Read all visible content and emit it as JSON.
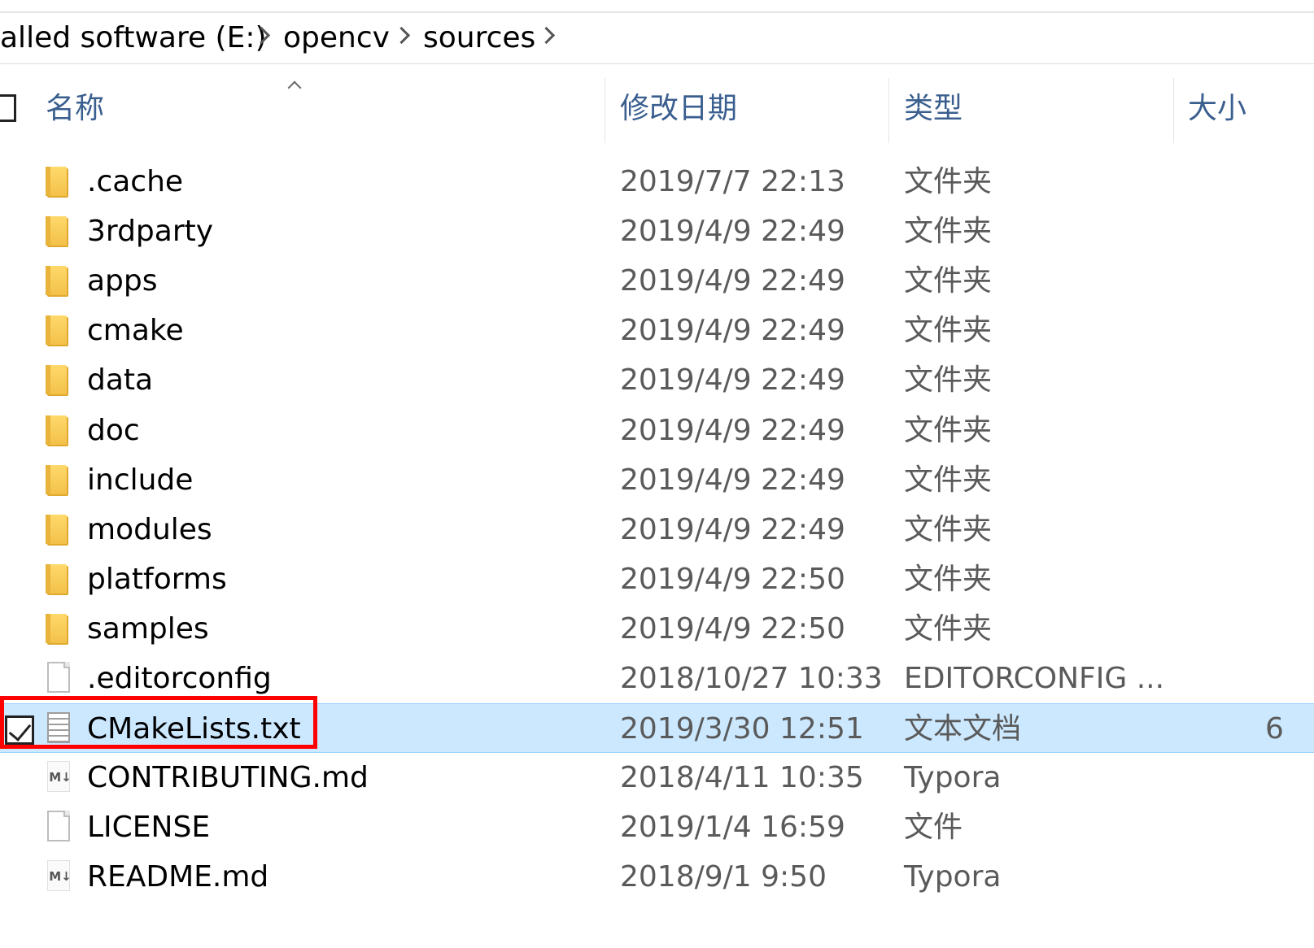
{
  "breadcrumb": {
    "items": [
      "alled software (E:)",
      "opencv",
      "sources"
    ]
  },
  "columns": {
    "name": "名称",
    "modified": "修改日期",
    "type": "类型",
    "size": "大小"
  },
  "files": [
    {
      "name": ".cache",
      "modified": "2019/7/7 22:13",
      "type": "文件夹",
      "size": "",
      "icon": "folder-icon"
    },
    {
      "name": "3rdparty",
      "modified": "2019/4/9 22:49",
      "type": "文件夹",
      "size": "",
      "icon": "folder-icon"
    },
    {
      "name": "apps",
      "modified": "2019/4/9 22:49",
      "type": "文件夹",
      "size": "",
      "icon": "folder-icon"
    },
    {
      "name": "cmake",
      "modified": "2019/4/9 22:49",
      "type": "文件夹",
      "size": "",
      "icon": "folder-icon"
    },
    {
      "name": "data",
      "modified": "2019/4/9 22:49",
      "type": "文件夹",
      "size": "",
      "icon": "folder-icon"
    },
    {
      "name": "doc",
      "modified": "2019/4/9 22:49",
      "type": "文件夹",
      "size": "",
      "icon": "folder-icon"
    },
    {
      "name": "include",
      "modified": "2019/4/9 22:49",
      "type": "文件夹",
      "size": "",
      "icon": "folder-icon"
    },
    {
      "name": "modules",
      "modified": "2019/4/9 22:49",
      "type": "文件夹",
      "size": "",
      "icon": "folder-icon"
    },
    {
      "name": "platforms",
      "modified": "2019/4/9 22:50",
      "type": "文件夹",
      "size": "",
      "icon": "folder-icon"
    },
    {
      "name": "samples",
      "modified": "2019/4/9 22:50",
      "type": "文件夹",
      "size": "",
      "icon": "folder-icon"
    },
    {
      "name": ".editorconfig",
      "modified": "2018/10/27 10:33",
      "type": "EDITORCONFIG ...",
      "size": "",
      "icon": "file-icon"
    },
    {
      "name": "CMakeLists.txt",
      "modified": "2019/3/30 12:51",
      "type": "文本文档",
      "size": "6",
      "icon": "text-file-icon",
      "selected": true,
      "checked": true
    },
    {
      "name": "CONTRIBUTING.md",
      "modified": "2018/4/11 10:35",
      "type": "Typora",
      "size": "",
      "icon": "markdown-file-icon"
    },
    {
      "name": "LICENSE",
      "modified": "2019/1/4 16:59",
      "type": "文件",
      "size": "",
      "icon": "file-icon"
    },
    {
      "name": "README.md",
      "modified": "2018/9/1 9:50",
      "type": "Typora",
      "size": "",
      "icon": "markdown-file-icon"
    }
  ],
  "icons": {
    "markdown_glyph": "M↓"
  },
  "colors": {
    "selection_bg": "#cce8ff",
    "header_text": "#3a5f8f",
    "highlight_border": "#ff0000"
  }
}
